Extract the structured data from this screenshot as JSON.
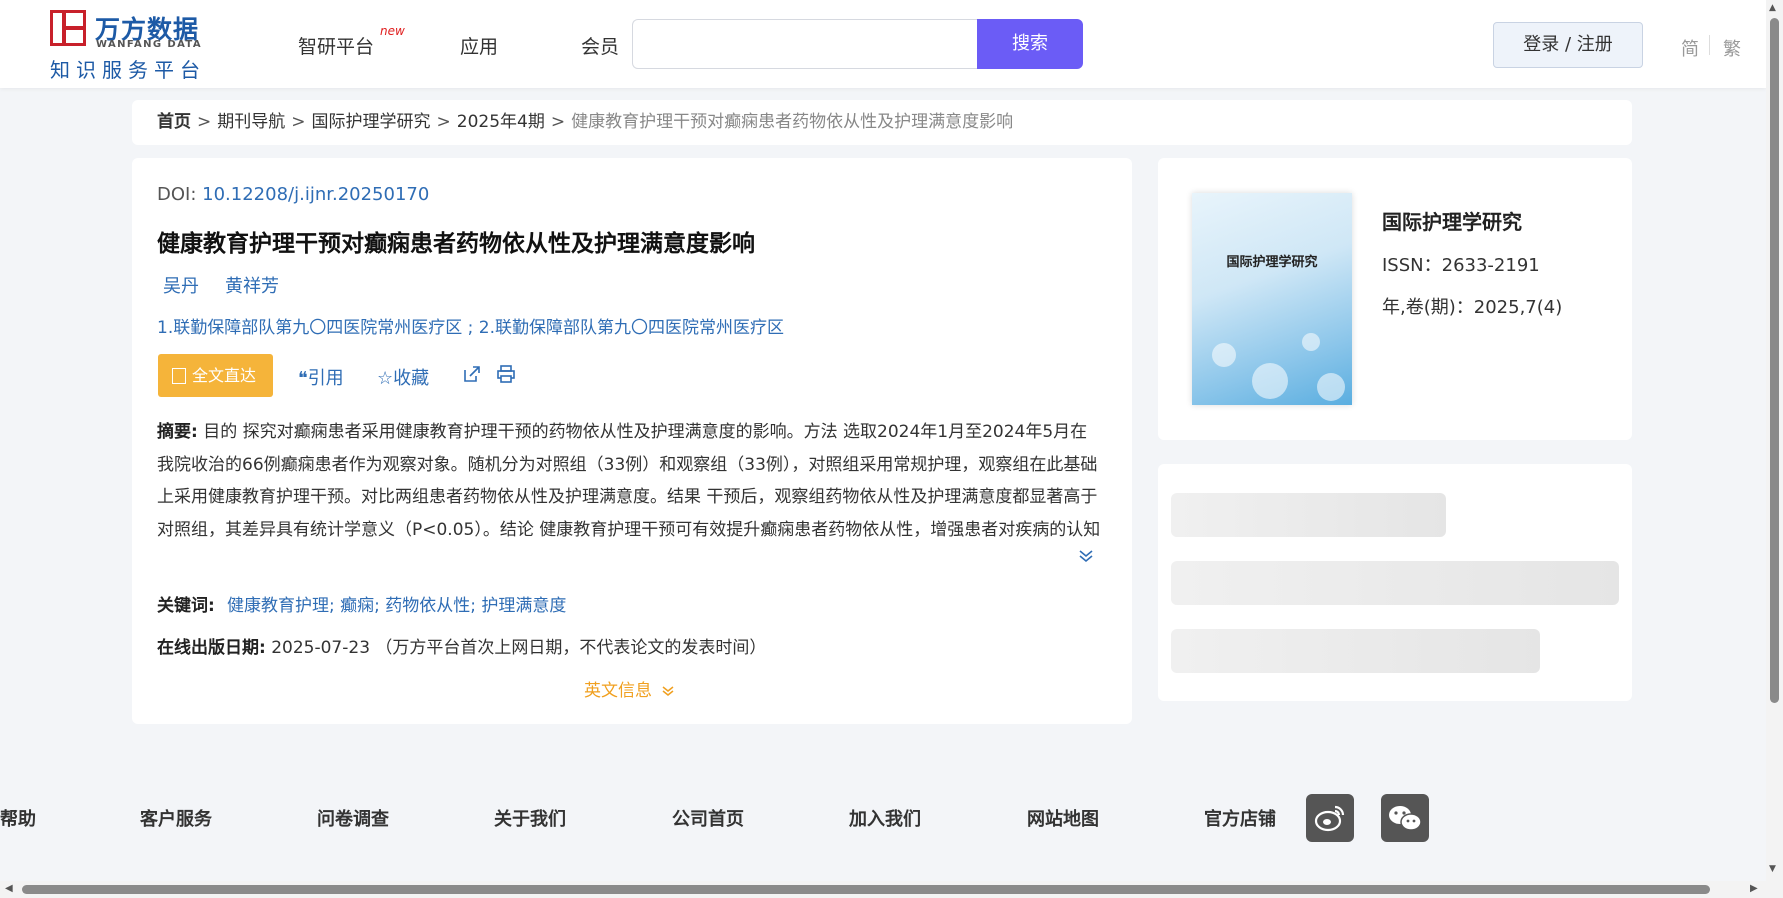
{
  "header": {
    "logo_cn": "万方数据",
    "logo_en": "WANFANG DATA",
    "logo_sub": "知识服务平台",
    "nav": [
      "智研平台",
      "应用",
      "会员"
    ],
    "nav_new_badge": "new",
    "search_placeholder": "",
    "search_button": "搜索",
    "login_button": "登录 / 注册",
    "lang_simplified": "简",
    "lang_traditional": "繁"
  },
  "breadcrumb": {
    "home": "首页",
    "items": [
      "期刊导航",
      "国际护理学研究",
      "2025年4期"
    ],
    "current": "健康教育护理干预对癫痫患者药物依从性及护理满意度影响",
    "separator": ">"
  },
  "article": {
    "doi_label": "DOI:",
    "doi_value": "10.12208/j.ijnr.20250170",
    "title": "健康教育护理干预对癫痫患者药物依从性及护理满意度影响",
    "authors": [
      "吴丹",
      "黄祥芳"
    ],
    "affiliations": "1.联勤保障部队第九〇四医院常州医疗区 ; 2.联勤保障部队第九〇四医院常州医疗区",
    "fulltext_button": "全文直达",
    "cite_label": "引用",
    "favorite_label": "收藏",
    "abstract_label": "摘要:",
    "abstract_text": "目的 探究对癫痫患者采用健康教育护理干预的药物依从性及护理满意度的影响。方法 选取2024年1月至2024年5月在我院收治的66例癫痫患者作为观察对象。随机分为对照组（33例）和观察组（33例），对照组采用常规护理，观察组在此基础上采用健康教育护理干预。对比两组患者药物依从性及护理满意度。结果 干预后，观察组药物依从性及护理满意度都显著高于对照组，其差异具有统计学意义（P<0.05）。结论 健康教育护理干预可有效提升癫痫患者药物依从性，增强患者对疾病的认知与自我管理能力，同时显著提高护理满意度，对癫痫患者的治疗与康复进程起到积极推动作用，值得临...",
    "keywords_label": "关键词:",
    "keywords": [
      "健康教育护理",
      "癫痫",
      "药物依从性",
      "护理满意度"
    ],
    "keyword_sep": ";",
    "pub_date_label": "在线出版日期:",
    "pub_date_value": "2025-07-23",
    "pub_date_note": "（万方平台首次上网日期，不代表论文的发表时间）",
    "english_info": "英文信息"
  },
  "journal": {
    "cover_title": "国际护理学研究",
    "name": "国际护理学研究",
    "issn": "ISSN：2633-2191",
    "volume": "年,卷(期)：2025,7(4)"
  },
  "footer": {
    "links": [
      "帮助",
      "客户服务",
      "问卷调查",
      "关于我们",
      "公司首页",
      "加入我们",
      "网站地图",
      "官方店铺"
    ]
  }
}
